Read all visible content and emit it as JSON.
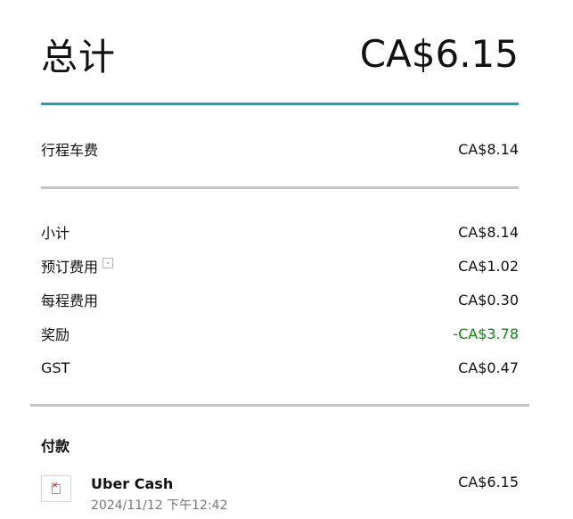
{
  "summary": {
    "total_label": "总计",
    "total_amount": "CA$6.15"
  },
  "trip_fare": {
    "label": "行程车费",
    "amount": "CA$8.14"
  },
  "breakdown": [
    {
      "label": "小计",
      "amount": "CA$8.14"
    },
    {
      "label": "预订费用",
      "amount": "CA$1.02",
      "icon": "info-icon"
    },
    {
      "label": "每程费用",
      "amount": "CA$0.30"
    },
    {
      "label": "奖励",
      "amount": "-CA$3.78",
      "color": "#0f8a12"
    },
    {
      "label": "GST",
      "amount": "CA$0.47"
    }
  ],
  "payment": {
    "title": "付款",
    "method_icon": "broken-image-icon",
    "method": "Uber Cash",
    "datetime": "2024/11/12 下午12:42",
    "amount": "CA$6.15"
  },
  "colors": {
    "accent_rule": "#1aa0b8",
    "divider": "#c4c4c4",
    "discount_green": "#0f8a12"
  }
}
